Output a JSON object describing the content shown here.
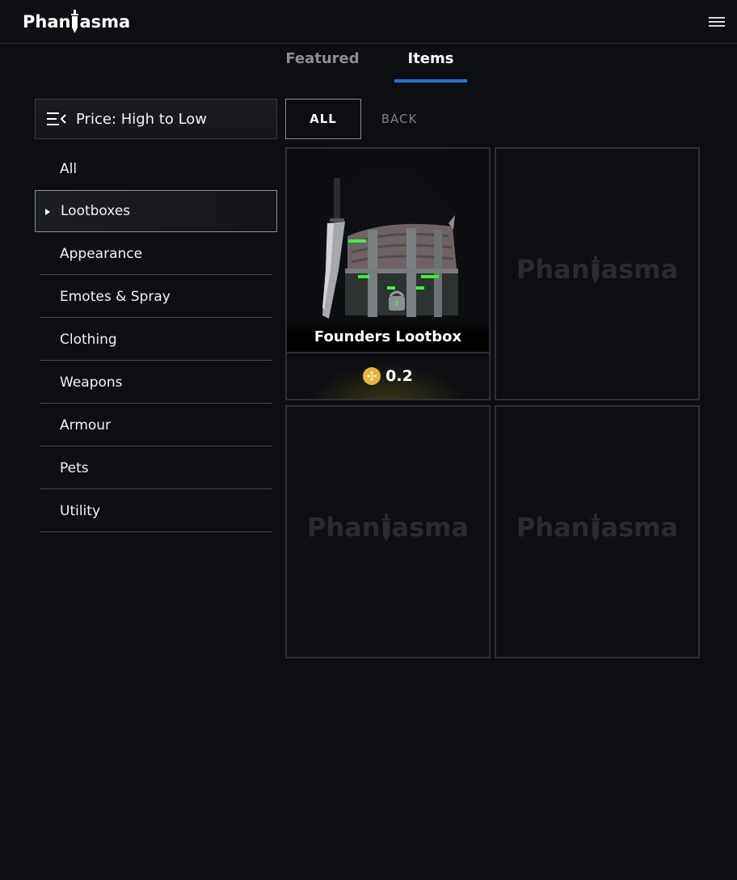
{
  "brand": {
    "logo_text_left": "Phan",
    "logo_text_right": "asma"
  },
  "tabs": [
    {
      "label": "Featured"
    },
    {
      "label": "Items"
    }
  ],
  "sort": {
    "label": "Price: High to Low"
  },
  "categories": [
    {
      "label": "All"
    },
    {
      "label": "Lootboxes"
    },
    {
      "label": "Appearance"
    },
    {
      "label": "Emotes & Spray"
    },
    {
      "label": "Clothing"
    },
    {
      "label": "Weapons"
    },
    {
      "label": "Armour"
    },
    {
      "label": "Pets"
    },
    {
      "label": "Utility"
    }
  ],
  "filters": {
    "all_label": "ALL",
    "back_label": "BACK"
  },
  "items": [
    {
      "name": "Founders Lootbox",
      "price": "0.2",
      "currency_icon": "bnb-coin-icon"
    }
  ],
  "placeholder": {
    "watermark_left": "Phan",
    "watermark_right": "asma"
  },
  "colors": {
    "accent": "#1f76d2",
    "coin": "#e7b53a",
    "background": "#0e0f13"
  }
}
